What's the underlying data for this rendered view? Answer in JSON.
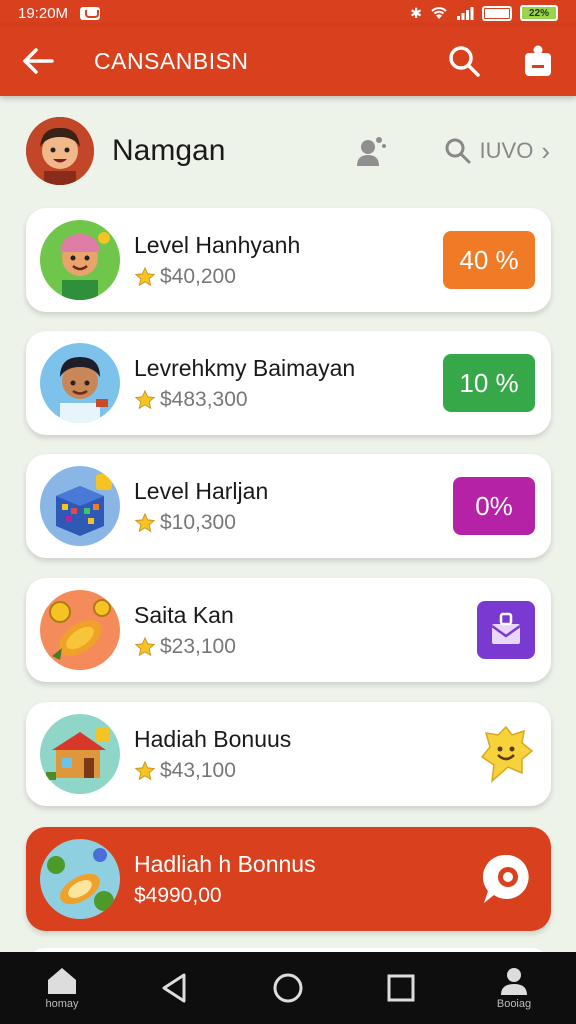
{
  "status_bar": {
    "time": "19:20M",
    "battery_right": "22%"
  },
  "app_bar": {
    "title": "CANSANBISN"
  },
  "profile": {
    "name": "Namgan",
    "search_text": "IUVO"
  },
  "cards": [
    {
      "title": "Level Hanhyanh",
      "amount": "$40,200",
      "badge_text": "40 %",
      "badge_color": "#f07a25"
    },
    {
      "title": "Levrehkmy Baimayan",
      "amount": "$483,300",
      "badge_text": "10 %",
      "badge_color": "#36a84a"
    },
    {
      "title": "Level Harljan",
      "amount": "$10,300",
      "badge_text": "0%",
      "badge_color": "#b522a5"
    },
    {
      "title": "Saita Kan",
      "amount": "$23,100",
      "badge_icon": "gift-envelope-icon",
      "badge_color": "#7a3ad1"
    },
    {
      "title": "Hadiah Bonuus",
      "amount": "$43,100",
      "badge_icon": "smiley-star-icon"
    },
    {
      "title": "Hadliah  h Bonnus",
      "amount": "$4990,00",
      "badge_icon": "chat-bubble-icon"
    }
  ],
  "nav": {
    "home_label": "homay",
    "profile_label": "Booiag"
  },
  "colors": {
    "brand": "#d9401e",
    "background": "#eef3ea"
  }
}
